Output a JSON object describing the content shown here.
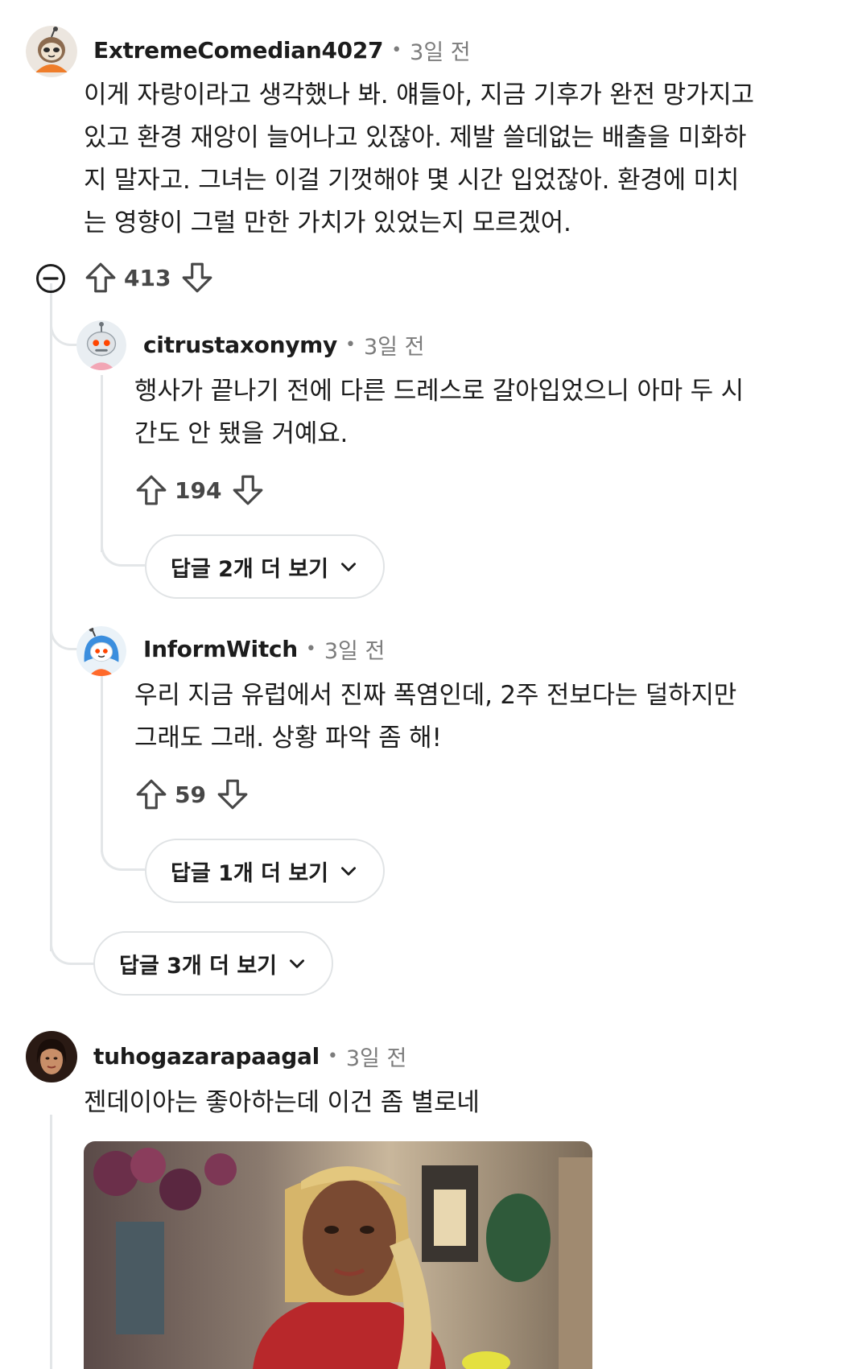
{
  "comments": [
    {
      "username": "ExtremeComedian4027",
      "time": "3일 전",
      "body_lines": [
        "이게 자랑이라고 생각했나 봐. 얘들아, 지금 기후가 완전 망가지고",
        "있고 환경 재앙이 늘어나고 있잖아. 제발 쓸데없는 배출을 미화하",
        "지 말자고. 그녀는 이걸 기껏해야 몇 시간 입었잖아. 환경에 미치",
        "는 영향이 그럴 만한 가치가 있었는지 모르겠어."
      ],
      "score": "413",
      "avatar": "sloth-avatar"
    },
    {
      "username": "citrustaxonymy",
      "time": "3일 전",
      "body_lines": [
        "행사가 끝나기 전에 다른 드레스로 갈아입었으니 아마 두 시",
        "간도 안 됐을 거예요."
      ],
      "score": "194",
      "more_replies": "답글 2개 더 보기",
      "avatar": "robot-snoo-avatar"
    },
    {
      "username": "InformWitch",
      "time": "3일 전",
      "body_lines": [
        "우리 지금 유럽에서 진짜 폭염인데, 2주 전보다는 덜하지만",
        "그래도 그래. 상황 파악 좀 해!"
      ],
      "score": "59",
      "more_replies": "답글 1개 더 보기",
      "avatar": "blue-hair-snoo-avatar"
    },
    {
      "username": "tuhogazarapaagal",
      "time": "3일 전",
      "body_lines": [
        "젠데이아는 좋아하는데 이건 좀 별로네"
      ],
      "avatar": "photo-avatar"
    }
  ],
  "thread_more_replies": "답글 3개 더 보기",
  "icons": {
    "upvote": "arrow-up-outline-icon",
    "downvote": "arrow-down-outline-icon",
    "collapse": "minus-circle-icon",
    "chevron": "chevron-down-icon"
  },
  "colors": {
    "thread_line": "#e3e6e8",
    "meta_gray": "#7c7c7c",
    "text": "#1c1c1c"
  }
}
